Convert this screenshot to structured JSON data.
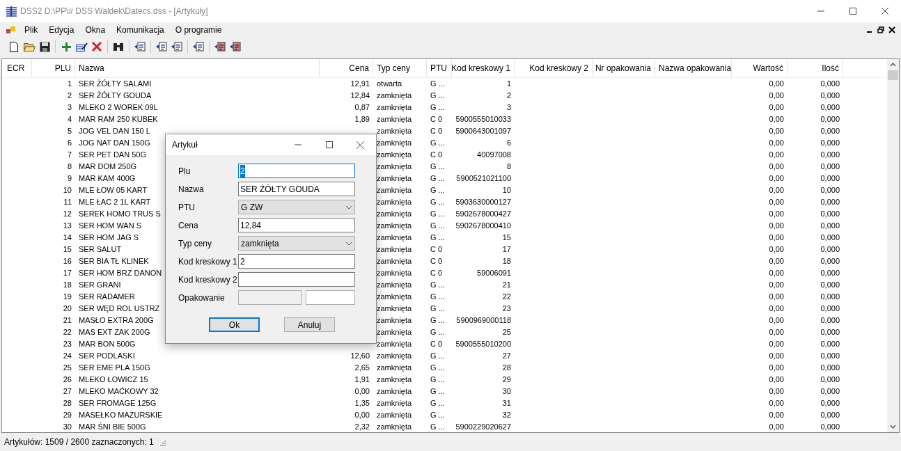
{
  "window": {
    "title": "DSS2 D:\\PP\\# DSS Waldek\\Datecs.dss - [Artykuły]"
  },
  "menu": [
    "Plik",
    "Edycja",
    "Okna",
    "Komunikacja",
    "O programie"
  ],
  "table": {
    "columns": [
      "ECR",
      "PLU",
      "Nazwa",
      "Cena",
      "Typ ceny",
      "PTU",
      "Kod kreskowy 1",
      "Kod kreskowy 2",
      "Nr opakowania",
      "Nazwa opakowania",
      "Wartość",
      "Ilość"
    ],
    "rows": [
      {
        "plu": "1",
        "nazwa": "SER ŻÓŁTY SALAMI",
        "cena": "12,91",
        "typ": "otwarta",
        "ptu": "G ...",
        "kod1": "1",
        "wartosc": "0,00",
        "ilosc": "0,000"
      },
      {
        "plu": "2",
        "nazwa": "SER ŻÓŁTY GOUDA",
        "cena": "12,84",
        "typ": "zamknięta",
        "ptu": "G ...",
        "kod1": "2",
        "wartosc": "0,00",
        "ilosc": "0,000"
      },
      {
        "plu": "3",
        "nazwa": "MLEKO 2 WOREK 09L",
        "cena": "0,87",
        "typ": "zamknięta",
        "ptu": "G ...",
        "kod1": "3",
        "wartosc": "0,00",
        "ilosc": "0,000"
      },
      {
        "plu": "4",
        "nazwa": "MAR RAM 250 KUBEK",
        "cena": "1,89",
        "typ": "zamknięta",
        "ptu": "C 0",
        "kod1": "5900555010033",
        "wartosc": "0,00",
        "ilosc": "0,000"
      },
      {
        "plu": "5",
        "nazwa": "JOG VEL DAN 150 L",
        "typ": "zamknięta",
        "ptu": "C 0",
        "kod1": "5900643001097",
        "wartosc": "0,00",
        "ilosc": "0,000"
      },
      {
        "plu": "6",
        "nazwa": "JOG NAT DAN 150G",
        "typ": "zamknięta",
        "ptu": "G ...",
        "kod1": "6",
        "wartosc": "0,00",
        "ilosc": "0,000"
      },
      {
        "plu": "7",
        "nazwa": "SER PET DAN 50G",
        "typ": "zamknięta",
        "ptu": "C 0",
        "kod1": "40097008",
        "wartosc": "0,00",
        "ilosc": "0,000"
      },
      {
        "plu": "8",
        "nazwa": "MAR DOM 250G",
        "typ": "zamknięta",
        "ptu": "G ...",
        "kod1": "8",
        "wartosc": "0,00",
        "ilosc": "0,000"
      },
      {
        "plu": "9",
        "nazwa": "MAR KAM 400G",
        "typ": "zamknięta",
        "ptu": "G ...",
        "kod1": "5900521021100",
        "wartosc": "0,00",
        "ilosc": "0,000"
      },
      {
        "plu": "10",
        "nazwa": "MLE ŁOW 05 KART",
        "typ": "zamknięta",
        "ptu": "G ...",
        "kod1": "10",
        "wartosc": "0,00",
        "ilosc": "0,000"
      },
      {
        "plu": "11",
        "nazwa": "MLE ŁAC 2 1L KART",
        "typ": "zamknięta",
        "ptu": "G ...",
        "kod1": "5903630000127",
        "wartosc": "0,00",
        "ilosc": "0,000"
      },
      {
        "plu": "12",
        "nazwa": "SEREK HOMO TRUS S",
        "typ": "zamknięta",
        "ptu": "G ...",
        "kod1": "5902678000427",
        "wartosc": "0,00",
        "ilosc": "0,000"
      },
      {
        "plu": "13",
        "nazwa": "SER HOM WAN S",
        "typ": "zamknięta",
        "ptu": "G ...",
        "kod1": "5902678000410",
        "wartosc": "0,00",
        "ilosc": "0,000"
      },
      {
        "plu": "14",
        "nazwa": "SER HOM JAG S",
        "typ": "zamknięta",
        "ptu": "G ...",
        "kod1": "15",
        "wartosc": "0,00",
        "ilosc": "0,000"
      },
      {
        "plu": "15",
        "nazwa": "SER SALUT",
        "typ": "zamknięta",
        "ptu": "C 0",
        "kod1": "17",
        "wartosc": "0,00",
        "ilosc": "0,000"
      },
      {
        "plu": "16",
        "nazwa": "SER BIA TŁ KLINEK",
        "typ": "zamknięta",
        "ptu": "C 0",
        "kod1": "18",
        "wartosc": "0,00",
        "ilosc": "0,000"
      },
      {
        "plu": "17",
        "nazwa": "SER HOM BRZ DANON",
        "typ": "zamknięta",
        "ptu": "C 0",
        "kod1": "59006091",
        "wartosc": "0,00",
        "ilosc": "0,000"
      },
      {
        "plu": "18",
        "nazwa": "SER GRANI",
        "typ": "zamknięta",
        "ptu": "G ...",
        "kod1": "21",
        "wartosc": "0,00",
        "ilosc": "0,000"
      },
      {
        "plu": "19",
        "nazwa": "SER RADAMER",
        "typ": "zamknięta",
        "ptu": "G ...",
        "kod1": "22",
        "wartosc": "0,00",
        "ilosc": "0,000"
      },
      {
        "plu": "20",
        "nazwa": "SER WĘD ROL USTRZ",
        "typ": "zamknięta",
        "ptu": "G ...",
        "kod1": "23",
        "wartosc": "0,00",
        "ilosc": "0,000"
      },
      {
        "plu": "21",
        "nazwa": "MASŁO EXTRA 200G",
        "typ": "zamknięta",
        "ptu": "G ...",
        "kod1": "5900969000118",
        "wartosc": "0,00",
        "ilosc": "0,000"
      },
      {
        "plu": "22",
        "nazwa": "MAS EXT ZAK 200G",
        "typ": "zamknięta",
        "ptu": "G ...",
        "kod1": "25",
        "wartosc": "0,00",
        "ilosc": "0,000"
      },
      {
        "plu": "23",
        "nazwa": "MAR BON 500G",
        "typ": "zamknięta",
        "ptu": "C 0",
        "kod1": "5900555010200",
        "wartosc": "0,00",
        "ilosc": "0,000"
      },
      {
        "plu": "24",
        "nazwa": "SER PODLASKI",
        "cena": "12,60",
        "typ": "zamknięta",
        "ptu": "G ...",
        "kod1": "27",
        "wartosc": "0,00",
        "ilosc": "0,000"
      },
      {
        "plu": "25",
        "nazwa": "SER EME PLA 150G",
        "cena": "2,65",
        "typ": "zamknięta",
        "ptu": "G ...",
        "kod1": "28",
        "wartosc": "0,00",
        "ilosc": "0,000"
      },
      {
        "plu": "26",
        "nazwa": "MLEKO ŁOWICZ 15",
        "cena": "1,91",
        "typ": "zamknięta",
        "ptu": "G ...",
        "kod1": "29",
        "wartosc": "0,00",
        "ilosc": "0,000"
      },
      {
        "plu": "27",
        "nazwa": "MLEKO MAĆKOWY 32",
        "cena": "0,00",
        "typ": "zamknięta",
        "ptu": "G ...",
        "kod1": "30",
        "wartosc": "0,00",
        "ilosc": "0,000"
      },
      {
        "plu": "28",
        "nazwa": "SER FROMAGE 125G",
        "cena": "1,35",
        "typ": "zamknięta",
        "ptu": "G ...",
        "kod1": "31",
        "wartosc": "0,00",
        "ilosc": "0,000"
      },
      {
        "plu": "29",
        "nazwa": "MASEŁKO MAZURSKIE",
        "cena": "0,00",
        "typ": "zamknięta",
        "ptu": "G ...",
        "kod1": "32",
        "wartosc": "0,00",
        "ilosc": "0,000"
      },
      {
        "plu": "30",
        "nazwa": "MAR ŚNI BIE 500G",
        "cena": "2,32",
        "typ": "zamknięta",
        "ptu": "G ...",
        "kod1": "5900229020627",
        "wartosc": "0,00",
        "ilosc": "0,000"
      }
    ]
  },
  "dialog": {
    "title": "Artykuł",
    "fields": [
      {
        "label": "Plu",
        "kind": "text",
        "value": "2",
        "highlighted": true,
        "disabled": false
      },
      {
        "label": "Nazwa",
        "kind": "text",
        "value": "SER ŻÓŁTY GOUDA",
        "highlighted": false,
        "disabled": false
      },
      {
        "label": "PTU",
        "kind": "select",
        "value": "G ZW"
      },
      {
        "label": "Cena",
        "kind": "text",
        "value": "12,84",
        "highlighted": false,
        "disabled": false
      },
      {
        "label": "Typ ceny",
        "kind": "select",
        "value": "zamknięta"
      },
      {
        "label": "Kod kreskowy 1",
        "kind": "text",
        "value": "2",
        "highlighted": false,
        "disabled": false
      },
      {
        "label": "Kod kreskowy 2",
        "kind": "text",
        "highlighted": false,
        "disabled": false
      },
      {
        "label": "Opakowanie",
        "kind": "pair",
        "parts": [
          {
            "disabled": true
          },
          {
            "disabled": false
          }
        ]
      }
    ],
    "buttons": [
      {
        "label": "Ok",
        "focused": true
      },
      {
        "label": "Anuluj",
        "focused": false
      }
    ]
  },
  "status_bar": "Artykułów: 1509 / 2600 zaznaczonych: 1"
}
